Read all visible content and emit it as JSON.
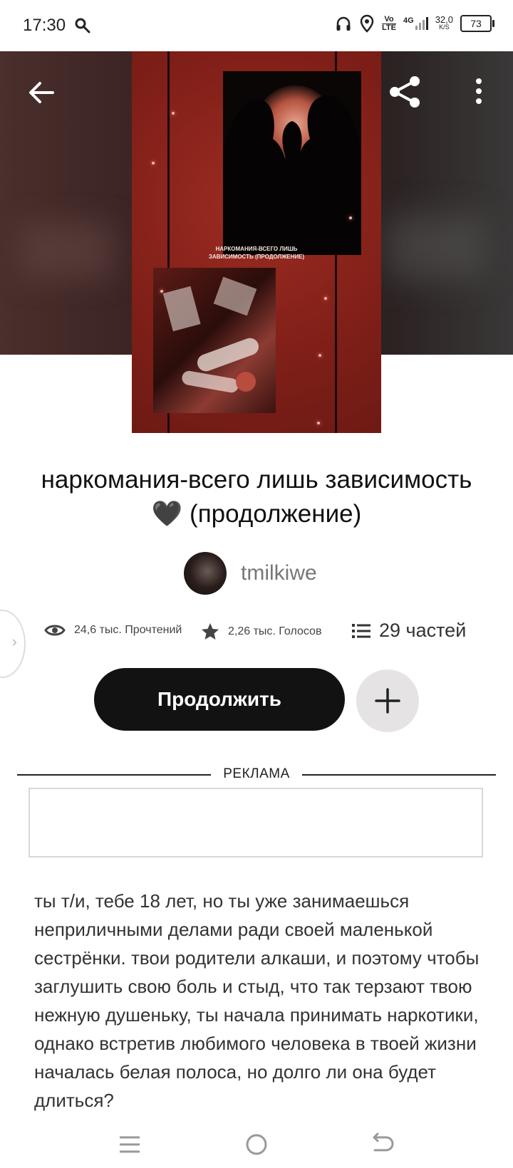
{
  "status_bar": {
    "time": "17:30",
    "volte_top": "Vo",
    "volte_bottom": "LTE",
    "network": "4G",
    "speed_value": "32,0",
    "speed_unit": "K/S",
    "battery": "73",
    "icons": [
      "search-icon",
      "headphones-icon",
      "location-icon",
      "signal-icon",
      "battery-icon"
    ]
  },
  "hero": {
    "cover_caption_line1": "НАРКОМАНИЯ-ВСЕГО ЛИШЬ",
    "cover_caption_line2": "ЗАВИСИМОСТЬ (ПРОДОЛЖЕНИЕ)",
    "colors": {
      "cover_red": "#8a241b",
      "hero_dark": "#3c2524"
    }
  },
  "story": {
    "title": "наркомания-всего лишь зависимость 🖤 (продолжение)",
    "author": "tmilkiwe",
    "reads": "24,6 тыс. Прочтений",
    "votes": "2,26 тыс. Голосов",
    "parts": "29 частей",
    "description": "ты т/и, тебе 18 лет, но ты уже занимаешься неприличными делами ради своей маленькой сестрёнки. твои родители алкаши, и поэтому чтобы заглушить свою боль и стыд, что так терзают твою нежную душеньку, ты начала принимать наркотики, однако встретив любимого человека в твоей жизни началась белая полоса, но долго ли она будет длиться?"
  },
  "actions": {
    "continue_label": "Продолжить",
    "add_icon": "plus-icon"
  },
  "ad": {
    "label": "РЕКЛАМА"
  },
  "nav": {
    "icons": [
      "menu-icon",
      "home-icon",
      "back-icon"
    ]
  }
}
